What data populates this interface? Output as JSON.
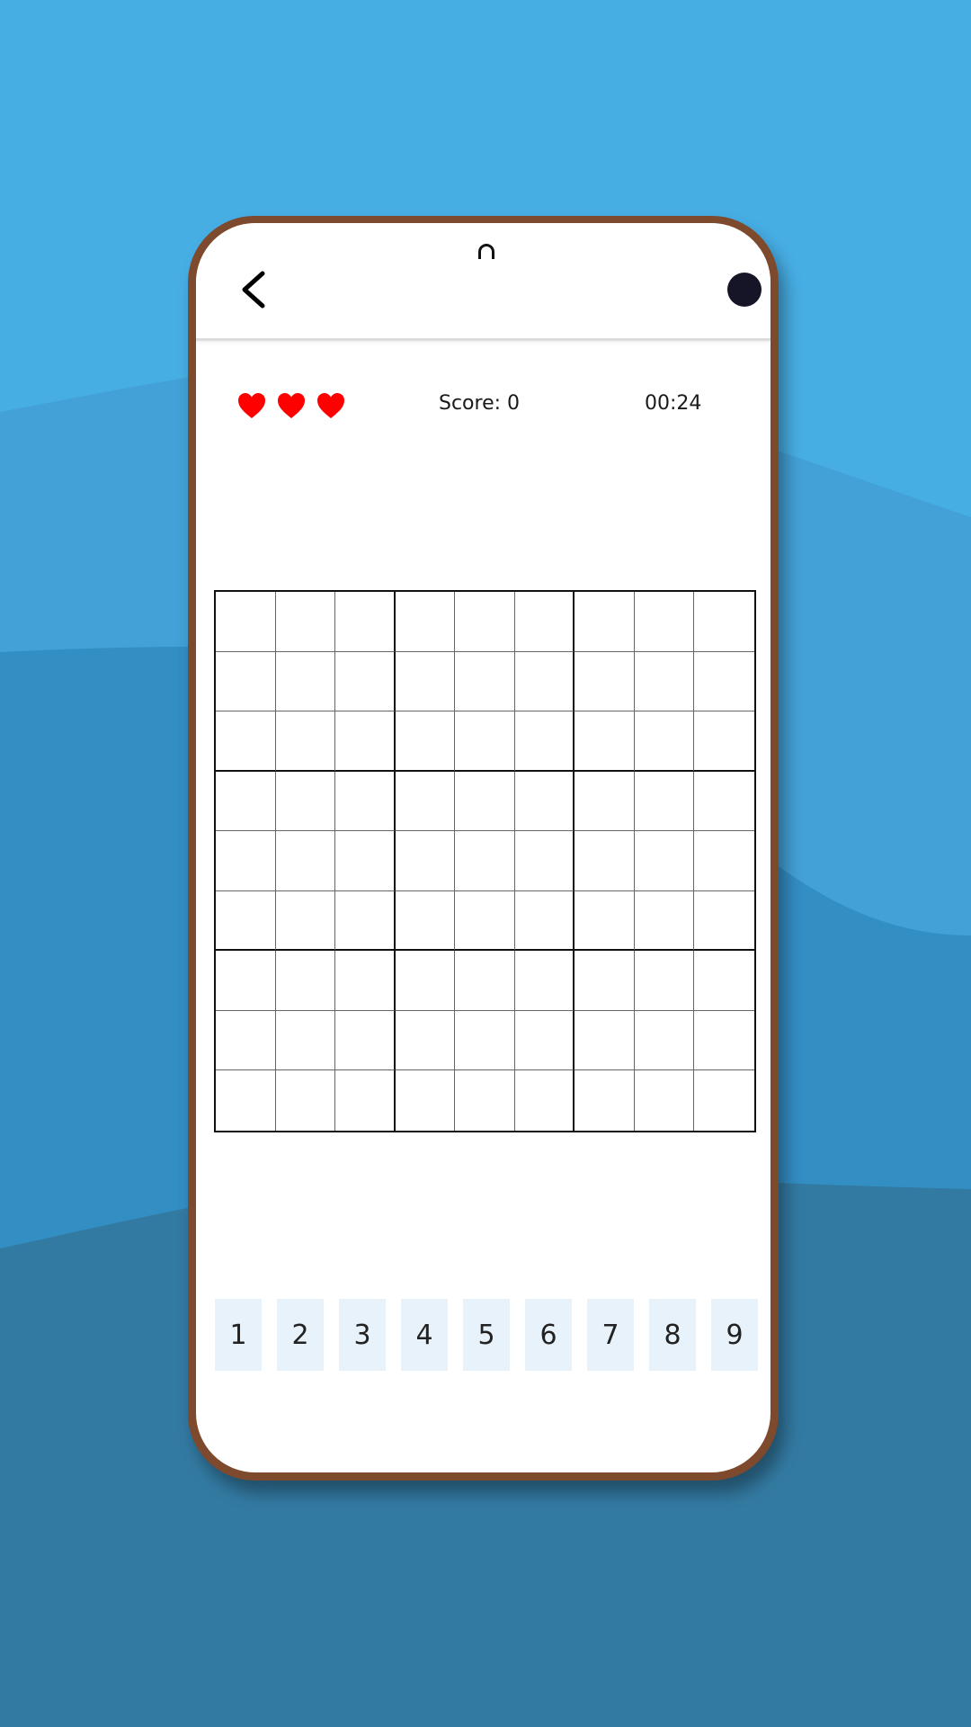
{
  "header": {
    "back_icon": "chevron-left-icon",
    "menu_icon": "circle-menu-icon",
    "camera_icon": "front-camera-icon"
  },
  "status": {
    "lives": 3,
    "heart_color": "#ff0000",
    "score_text": "Score: 0",
    "timer_text": "00:24"
  },
  "board": {
    "size": 9,
    "cells": [
      [
        "",
        "",
        "",
        "",
        "",
        "",
        "",
        "",
        ""
      ],
      [
        "",
        "",
        "",
        "",
        "",
        "",
        "",
        "",
        ""
      ],
      [
        "",
        "",
        "",
        "",
        "",
        "",
        "",
        "",
        ""
      ],
      [
        "",
        "",
        "",
        "",
        "",
        "",
        "",
        "",
        ""
      ],
      [
        "",
        "",
        "",
        "",
        "",
        "",
        "",
        "",
        ""
      ],
      [
        "",
        "",
        "",
        "",
        "",
        "",
        "",
        "",
        ""
      ],
      [
        "",
        "",
        "",
        "",
        "",
        "",
        "",
        "",
        ""
      ],
      [
        "",
        "",
        "",
        "",
        "",
        "",
        "",
        "",
        ""
      ],
      [
        "",
        "",
        "",
        "",
        "",
        "",
        "",
        "",
        ""
      ]
    ]
  },
  "numpad": {
    "keys": [
      "1",
      "2",
      "3",
      "4",
      "5",
      "6",
      "7",
      "8",
      "9"
    ],
    "key_background": "#e8f2fa"
  },
  "theme": {
    "background_top": "#47aee4",
    "background_mid": "#338ec4",
    "background_bottom": "#337aa2",
    "phone_frame": "#7d4a2e",
    "menu_dot": "#161527"
  }
}
